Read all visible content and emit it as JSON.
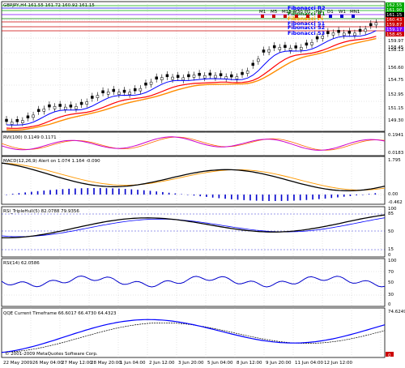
{
  "colors": {
    "background": "#ffffff",
    "grid": "#c0c0c0",
    "bull": "#000000",
    "bear": "#000000",
    "ma_fast": "#0000ff",
    "ma_mid": "#ff0000",
    "ma_slow": "#ff8c00",
    "rvi_main": "#cc00cc",
    "rvi_signal": "#ff6600",
    "macd_main": "#000000",
    "macd_signal": "#ff9900",
    "macd_hist": "#0000cc",
    "rsi_main": "#000000",
    "rsi_signal": "#0000ff",
    "rsi14": "#0000cc",
    "qqe_main": "#0000ff",
    "qqe_trail": "#000000",
    "fib_r2": "#0000ff",
    "fib_r1": "#008000",
    "fib_pivot": "#ffa500",
    "fib_s": "#cc0000",
    "green_line": "#00aa00",
    "purple_line": "#8000ff"
  },
  "main": {
    "header": "GBPJPY,H4  161.55 161.72 160.92 161.15",
    "price_ticks": [
      "162.45",
      "161.15",
      "159.97",
      "158.45",
      "158.13",
      "156.60",
      "154.75",
      "152.95",
      "151.15",
      "149.30"
    ],
    "fibo_labels": [
      "Fibonacci R2",
      "Fibonacci R1",
      "Fibonacci Pi",
      "Fibonacci S1",
      "Fibonacci S2",
      "Fibonacci S3"
    ],
    "timeframes": [
      "M1",
      "M5",
      "M15",
      "M30",
      "H1",
      "H4",
      "D1",
      "W1",
      "MN1"
    ],
    "tag_values": [
      "162.55",
      "161.90",
      "161.15",
      "160.43",
      "159.87",
      "159.17",
      "158.45"
    ]
  },
  "rvi": {
    "label": "RVI(100) 0.1149 0.1171",
    "ticks": [
      "0.1941",
      "0.0183"
    ]
  },
  "macd": {
    "label": "MACD(12,26,9) Alert on  1.074 1.164 -0.090",
    "ticks": [
      "1.795",
      "0.00",
      "-0.462"
    ]
  },
  "rsi_triple": {
    "label": "RSI_TripleHull(5) 82.0788 79.9356",
    "ticks": [
      "100",
      "85",
      "50",
      "15",
      "0"
    ]
  },
  "rsi14": {
    "label": "RSI(14) 62.0586",
    "ticks": [
      "100",
      "70",
      "50",
      "30",
      "0"
    ]
  },
  "qqe": {
    "label": "QQE Current Timeframe 66.6017 66.4730 64.4323",
    "ticks": [
      "74.6249",
      "0"
    ]
  },
  "footer": {
    "copyright": "© 2001-2009 MetaQuotes Software Corp."
  },
  "time_axis": [
    "22 May 2009",
    "26 May 04:00",
    "27 May 12:00",
    "28 May 20:00",
    "1 Jun 04:00",
    "2 Jun 12:00",
    "3 Jun 20:00",
    "5 Jun 04:00",
    "8 Jun 12:00",
    "9 Jun 20:00",
    "11 Jun 04:00",
    "12 Jun 12:00"
  ]
}
